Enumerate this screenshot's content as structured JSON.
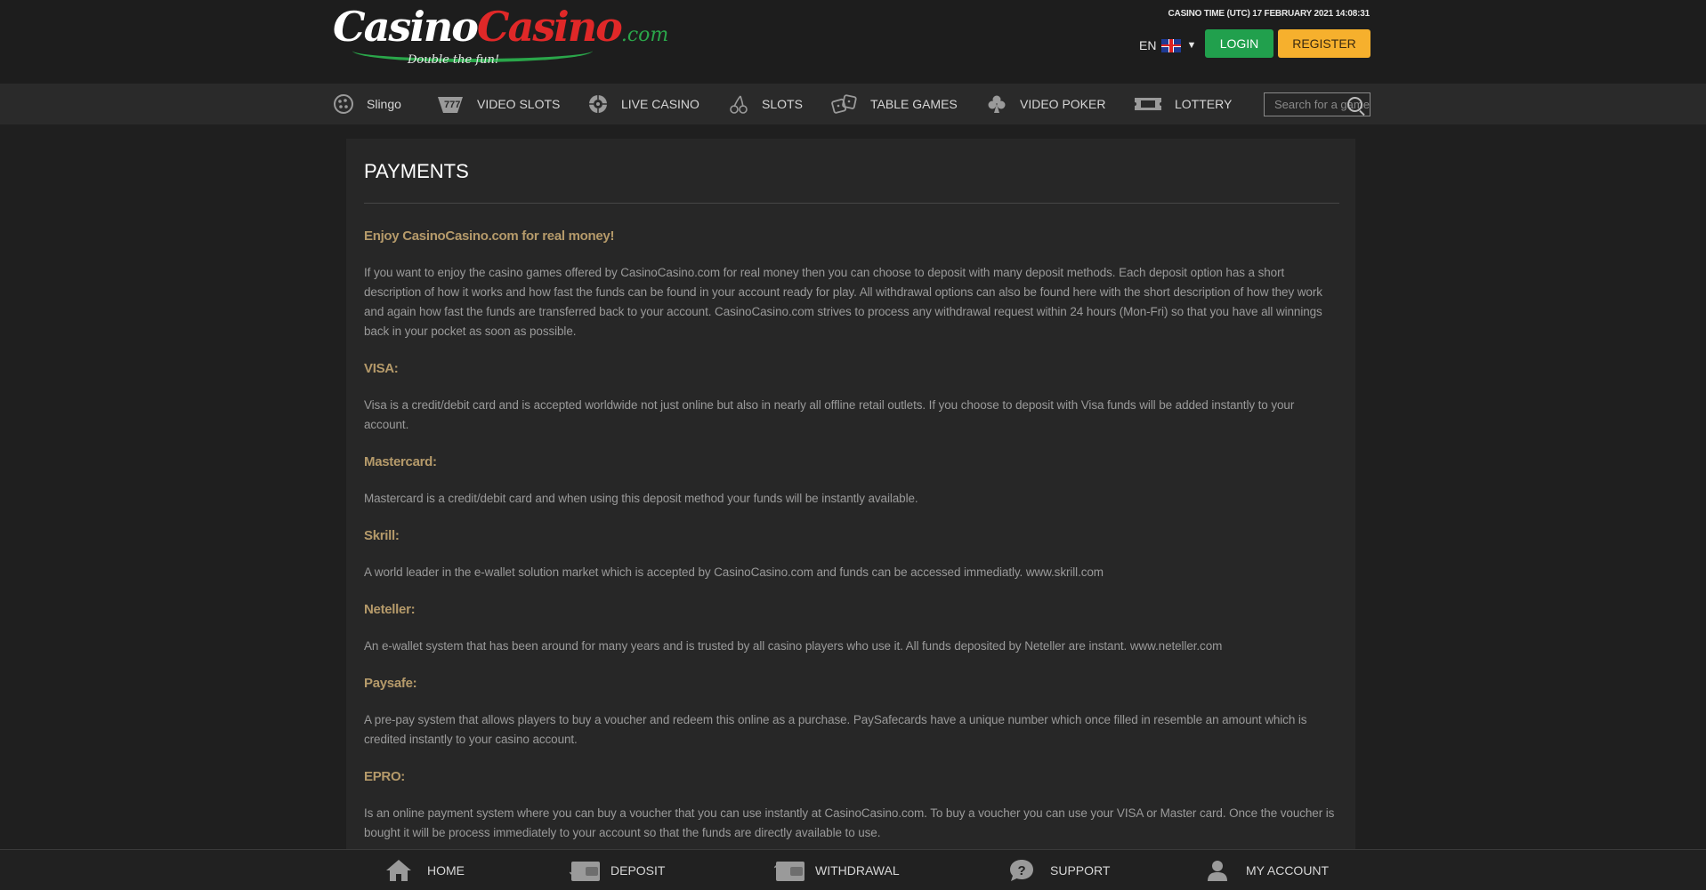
{
  "header": {
    "logo": {
      "part1": "Casino",
      "part2": "Casino",
      "suffix": ".com",
      "tagline": "Double the fun!"
    },
    "casino_time": "CASINO TIME (UTC)  17 FEBRUARY 2021  14:08:31",
    "language": "EN",
    "login_label": "LOGIN",
    "register_label": "REGISTER"
  },
  "nav": {
    "items": [
      {
        "label": "Slingo",
        "icon": "slingo-icon"
      },
      {
        "label": "VIDEO SLOTS",
        "icon": "video-slots-icon"
      },
      {
        "label": "LIVE CASINO",
        "icon": "roulette-icon"
      },
      {
        "label": "SLOTS",
        "icon": "cherries-icon"
      },
      {
        "label": "TABLE GAMES",
        "icon": "dice-icon"
      },
      {
        "label": "VIDEO POKER",
        "icon": "club-icon"
      },
      {
        "label": "LOTTERY",
        "icon": "ticket-icon"
      }
    ],
    "search_placeholder": "Search for a game"
  },
  "page": {
    "title": "PAYMENTS",
    "sections": [
      {
        "heading": "Enjoy CasinoCasino.com for real money!",
        "body": "If you want to enjoy the casino games offered by CasinoCasino.com for real money then you can choose to deposit with many deposit methods. Each deposit option has a short description of how it works and how fast the funds can be found in your account ready for play. All withdrawal options can also be found here with the short description of how they work and again how fast the funds are transferred back to your account. CasinoCasino.com strives to process any withdrawal request within 24 hours (Mon-Fri) so that you have all winnings back in your pocket as soon as possible."
      },
      {
        "heading": "VISA:",
        "body": "Visa is a credit/debit card and is accepted worldwide not just online but also in nearly all offline retail outlets. If you choose to deposit with Visa funds will be added instantly to your account."
      },
      {
        "heading": "Mastercard:",
        "body": "Mastercard is a credit/debit card and when using this deposit method your funds will be instantly available."
      },
      {
        "heading": "Skrill:",
        "body": "A world leader in the e-wallet solution market which is accepted by CasinoCasino.com and funds can be accessed immediatly. www.skrill.com"
      },
      {
        "heading": "Neteller:",
        "body": "An e-wallet system that has been around for many years and is trusted by all casino players who use it. All funds deposited by Neteller are instant. www.neteller.com"
      },
      {
        "heading": "Paysafe:",
        "body": "A pre-pay system that allows players to buy a voucher and redeem this online as a purchase. PaySafecards have a unique number which once filled in resemble an amount which is credited instantly to your casino account."
      },
      {
        "heading": "EPRO:",
        "body": "Is an online payment system where you can buy a voucher that you can use instantly at CasinoCasino.com. To buy a voucher you can use your VISA or Master card. Once the voucher is bought it will be process immediately to your account so that the funds are directly available to use."
      }
    ]
  },
  "footer": {
    "items": [
      {
        "label": "HOME",
        "icon": "home-icon"
      },
      {
        "label": "DEPOSIT",
        "icon": "deposit-wallet-icon"
      },
      {
        "label": "WITHDRAWAL",
        "icon": "withdrawal-wallet-icon"
      },
      {
        "label": "SUPPORT",
        "icon": "support-icon"
      },
      {
        "label": "MY ACCOUNT",
        "icon": "account-icon"
      }
    ]
  },
  "colors": {
    "background": "#1f1f1f",
    "panel": "#272727",
    "nav": "#2a2a2a",
    "login_green": "#21a04d",
    "register_orange": "#f6b02d",
    "heading_gold": "#b59a6a",
    "logo_red": "#e02828",
    "logo_green": "#2aa64a"
  }
}
